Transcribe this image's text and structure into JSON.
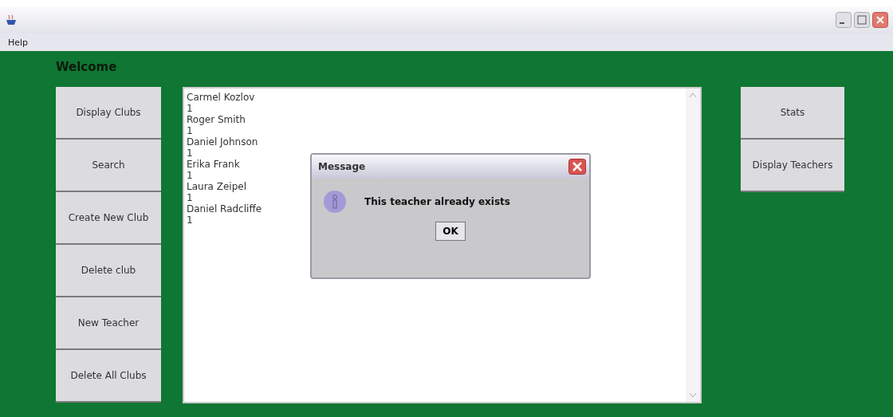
{
  "menu": [
    "Help"
  ],
  "welcome": "Welcome",
  "left_buttons": [
    "Display Clubs",
    "Search",
    "Create New Club",
    "Delete club",
    "New Teacher",
    "Delete All Clubs"
  ],
  "list_lines": [
    "Carmel Kozlov",
    "1",
    "Roger Smith",
    "1",
    "Daniel Johnson",
    "1",
    "Erika Frank",
    "1",
    "Laura Zeipel",
    "1",
    "Daniel Radcliffe",
    "1"
  ],
  "right_buttons": [
    "Stats",
    "Display Teachers"
  ],
  "dialog": {
    "title": "Message",
    "message": "This teacher already exists",
    "button": "OK"
  }
}
